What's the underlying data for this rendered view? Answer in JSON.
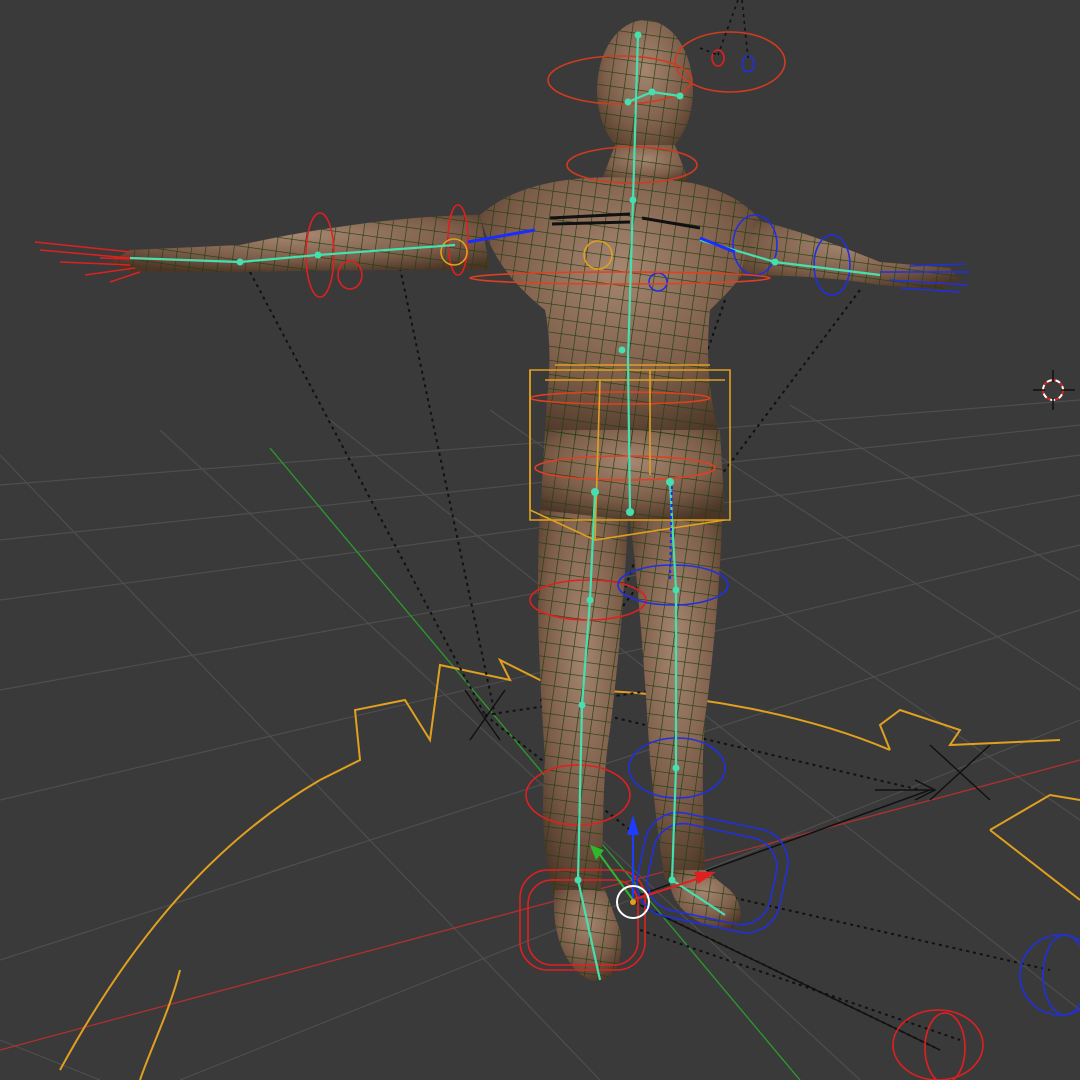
{
  "app": {
    "title": "",
    "view_label": ""
  },
  "viewport": {
    "background": "#3a3a3a",
    "grid_color": "#4d4d4d",
    "grid_major_color": "#575757"
  },
  "colors": {
    "mesh_wire": "#1f3d10",
    "skin": "#8a6a55",
    "bone": "#45e0b0",
    "bone_selected": "#1a2cff",
    "control_left": "#e02020",
    "control_right": "#2030e0",
    "control_center": "#e07a20",
    "root_control": "#e8a820",
    "x_axis": "#c03030",
    "y_axis": "#3aa03a",
    "z_axis_gizmo": "#1e3cff"
  },
  "icons": {
    "cursor": "3d-cursor-icon",
    "manipulator": "transform-manipulator-icon"
  }
}
